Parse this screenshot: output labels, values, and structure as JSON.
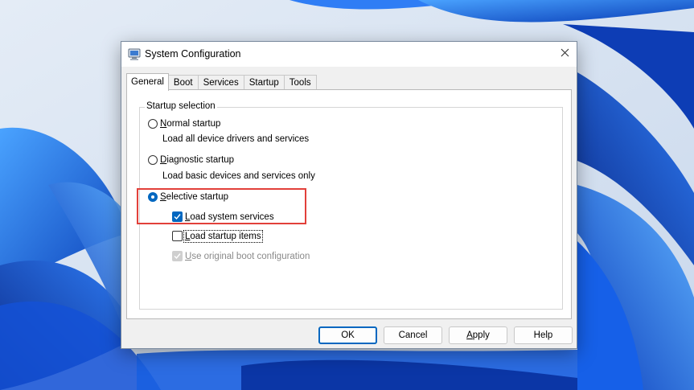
{
  "window": {
    "title": "System Configuration"
  },
  "icons": {
    "app": "msconfig-icon",
    "close": "close-icon"
  },
  "tabs": [
    {
      "label": "General",
      "active": true
    },
    {
      "label": "Boot",
      "active": false
    },
    {
      "label": "Services",
      "active": false
    },
    {
      "label": "Startup",
      "active": false
    },
    {
      "label": "Tools",
      "active": false
    }
  ],
  "startup_selection": {
    "legend": "Startup selection",
    "normal": {
      "label": "Normal startup",
      "description": "Load all device drivers and services",
      "selected": false
    },
    "diagnostic": {
      "label": "Diagnostic startup",
      "description": "Load basic devices and services only",
      "selected": false
    },
    "selective": {
      "label": "Selective startup",
      "selected": true,
      "options": [
        {
          "label": "Load system services",
          "checked": true,
          "enabled": true
        },
        {
          "label": "Load startup items",
          "checked": false,
          "enabled": true
        },
        {
          "label": "Use original boot configuration",
          "checked": true,
          "enabled": false
        }
      ]
    }
  },
  "buttons": {
    "ok": "OK",
    "cancel": "Cancel",
    "apply": "Apply",
    "help": "Help"
  },
  "colors": {
    "accent": "#0067c0",
    "highlight": "#e2403a"
  }
}
